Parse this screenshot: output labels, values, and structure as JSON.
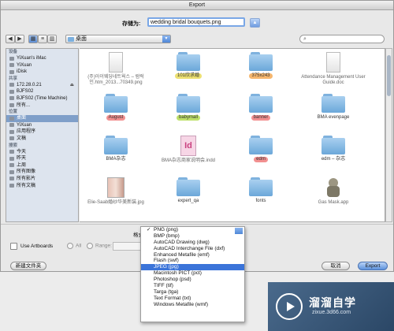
{
  "window": {
    "title": "Export"
  },
  "save_as": {
    "label": "存储为:",
    "filename": "wedding bridal bouquets.png"
  },
  "toolbar": {
    "back": "◀",
    "forward": "▶",
    "location": "桌面"
  },
  "sidebar": {
    "sections": [
      {
        "header": "设备",
        "items": [
          {
            "label": "YiXuan's iMac",
            "icon": "imac-icon"
          },
          {
            "label": "YiXuan",
            "icon": "disk-icon"
          },
          {
            "label": "iDisk",
            "icon": "idisk-icon"
          }
        ]
      },
      {
        "header": "共享",
        "items": [
          {
            "label": "172.28.0.21",
            "icon": "server-icon",
            "eject": "⏏"
          },
          {
            "label": "BJFS02",
            "icon": "server-icon"
          },
          {
            "label": "BJFS02 (Time Machine)",
            "icon": "server-icon"
          },
          {
            "label": "所有...",
            "icon": "network-icon"
          }
        ]
      },
      {
        "header": "位置",
        "items": [
          {
            "label": "桌面",
            "icon": "desktop-icon",
            "selected": true
          },
          {
            "label": "YiXuan",
            "icon": "home-icon"
          },
          {
            "label": "应用程序",
            "icon": "applications-icon"
          },
          {
            "label": "文稿",
            "icon": "documents-icon"
          }
        ]
      },
      {
        "header": "搜索",
        "items": [
          {
            "label": "今天",
            "icon": "clock-icon"
          },
          {
            "label": "昨天",
            "icon": "clock-icon"
          },
          {
            "label": "上周",
            "icon": "clock-icon"
          },
          {
            "label": "所有图像",
            "icon": "search-folder-icon"
          },
          {
            "label": "所有影片",
            "icon": "search-folder-icon"
          },
          {
            "label": "所有文稿",
            "icon": "search-folder-icon"
          }
        ]
      }
    ]
  },
  "files": [
    {
      "label": "(주)아이웨딩네트웍스 – 럼럭 인.htm_2013...70349.png",
      "kind": "doc",
      "color": "gray"
    },
    {
      "label": "101欣求婚",
      "kind": "folder",
      "color": "yellow"
    },
    {
      "label": "375x243",
      "kind": "folder",
      "color": "orange"
    },
    {
      "label": "Attendance Management User Guide.doc",
      "kind": "doc",
      "color": "gray"
    },
    {
      "label": "August",
      "kind": "folder",
      "color": "red"
    },
    {
      "label": "babymall",
      "kind": "folder",
      "color": "green"
    },
    {
      "label": "banner",
      "kind": "folder",
      "color": "red"
    },
    {
      "label": "BMA evenpage",
      "kind": "folder",
      "color": ""
    },
    {
      "label": "BMA杂志",
      "kind": "folder",
      "color": ""
    },
    {
      "label": "BMA杂志商家说明会.indd",
      "kind": "indd",
      "color": "gray"
    },
    {
      "label": "edm",
      "kind": "folder",
      "color": "red"
    },
    {
      "label": "edm – 杂志",
      "kind": "folder",
      "color": ""
    },
    {
      "label": "Elie-Saab婚纱华美新装.jpg",
      "kind": "image",
      "color": "gray"
    },
    {
      "label": "expert_qa",
      "kind": "folder",
      "color": ""
    },
    {
      "label": "fonts",
      "kind": "folder",
      "color": ""
    },
    {
      "label": "Gas Mask.app",
      "kind": "app",
      "color": "gray"
    }
  ],
  "format": {
    "label": "格式:",
    "options": [
      "PNG (png)",
      "BMP (bmp)",
      "AutoCAD Drawing (dwg)",
      "AutoCAD Interchange File (dxf)",
      "Enhanced Metafile (emf)",
      "Flash (swf)",
      "JPEG (jpg)",
      "Macintosh PICT (pct)",
      "Photoshop (psd)",
      "TIFF (tif)",
      "Targa (tga)",
      "Text Format (txt)",
      "Windows Metafile (wmf)"
    ],
    "checked_index": 0,
    "highlighted_index": 6
  },
  "options": {
    "use_artboards": "Use Artboards",
    "all": "All",
    "range": "Range:"
  },
  "buttons": {
    "new_folder": "新建文件夹",
    "cancel": "取消",
    "export": "Export"
  },
  "watermark": {
    "brand": "溜溜自学",
    "url": "zixue.3d66.com"
  }
}
